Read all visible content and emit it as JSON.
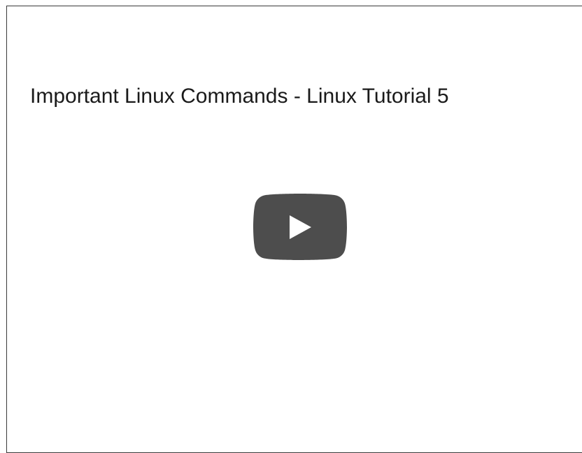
{
  "video": {
    "title": "Important Linux Commands - Linux Tutorial 5",
    "play_icon": "youtube-play-icon"
  },
  "colors": {
    "play_button_bg": "#4d4d4d",
    "play_triangle": "#ffffff",
    "title_text": "#1a1a1a",
    "frame_border": "#3a3a3a"
  }
}
